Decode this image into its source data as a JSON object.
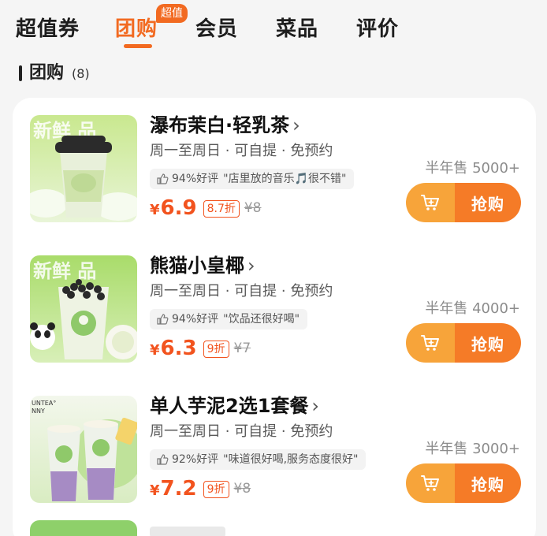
{
  "tabs": [
    {
      "label": "超值券",
      "active": false
    },
    {
      "label": "团购",
      "active": true,
      "badge": "超值"
    },
    {
      "label": "会员",
      "active": false
    },
    {
      "label": "菜品",
      "active": false
    },
    {
      "label": "评价",
      "active": false
    }
  ],
  "section": {
    "title": "团购",
    "count": "(8)"
  },
  "buy_label": "抢购",
  "currency": "¥",
  "colors": {
    "accent": "#f26a21",
    "price": "#f2531e",
    "cart_btn": "#f7a43a",
    "buy_btn": "#f57b27"
  },
  "items": [
    {
      "title": "瀑布茉白·轻乳茶",
      "subtitle": "周一至周日 · 可自提 · 免预约",
      "rating": "94%好评",
      "review": "\"店里放的音乐🎵很不错\"",
      "price": "6.9",
      "discount": "8.7折",
      "original": "¥8",
      "sales": "半年售 5000+",
      "image": "milk-tea-cup-with-black-lid"
    },
    {
      "title": "熊猫小皇椰",
      "subtitle": "周一至周日 · 可自提 · 免预约",
      "rating": "94%好评",
      "review": "\"饮品还很好喝\"",
      "price": "6.3",
      "discount": "9折",
      "original": "¥7",
      "sales": "半年售 4000+",
      "image": "coconut-drink-with-panda"
    },
    {
      "title": "单人芋泥2选1套餐",
      "subtitle": "周一至周日 · 可自提 · 免预约",
      "rating": "92%好评",
      "review": "\"味道很好喝,服务态度很好\"",
      "price": "7.2",
      "discount": "9折",
      "original": "¥8",
      "sales": "半年售 3000+",
      "image": "taro-paste-drinks"
    }
  ]
}
